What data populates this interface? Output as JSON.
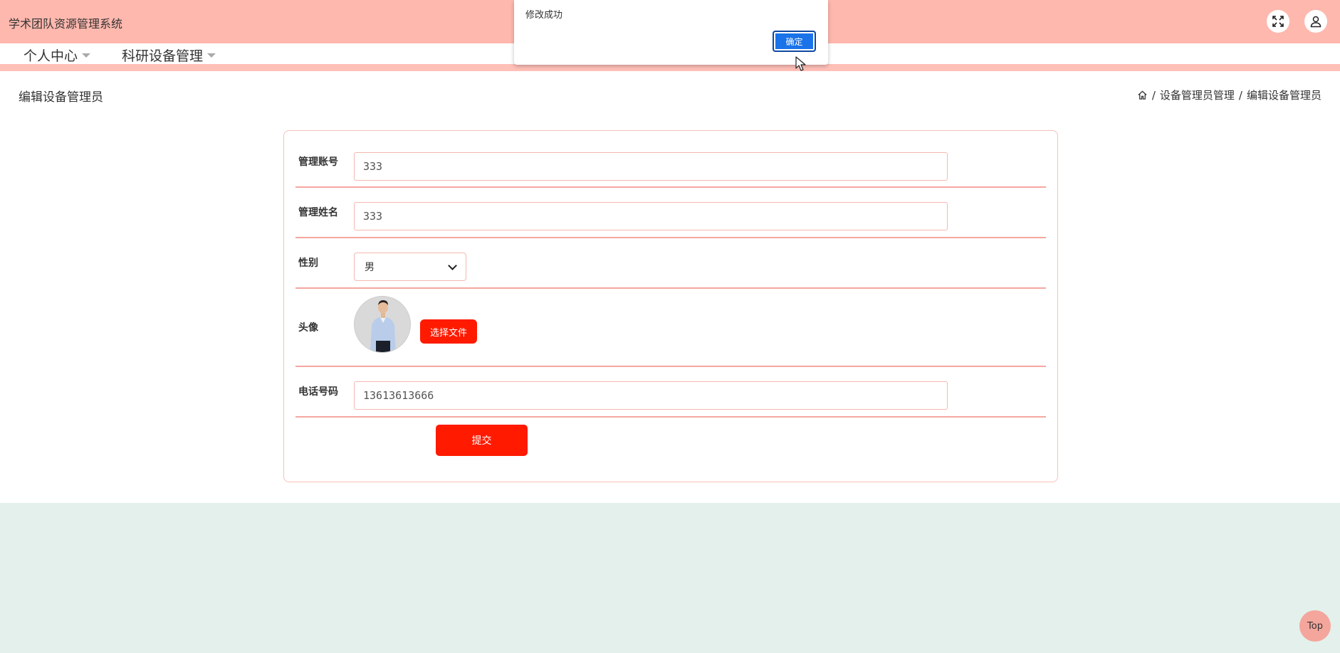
{
  "header": {
    "app_title": "学术团队资源管理系统"
  },
  "nav": {
    "items": [
      {
        "label": "个人中心"
      },
      {
        "label": "科研设备管理"
      }
    ]
  },
  "page": {
    "title": "编辑设备管理员",
    "breadcrumb": {
      "separator": "/",
      "items": [
        "设备管理员管理",
        "编辑设备管理员"
      ]
    }
  },
  "form": {
    "account": {
      "label": "管理账号",
      "value": "333"
    },
    "name": {
      "label": "管理姓名",
      "value": "333"
    },
    "gender": {
      "label": "性别",
      "value": "男"
    },
    "avatar": {
      "label": "头像",
      "file_button": "选择文件"
    },
    "phone": {
      "label": "电话号码",
      "value": "13613613666"
    },
    "submit_label": "提交"
  },
  "dialog": {
    "message": "修改成功",
    "ok_label": "确定"
  },
  "back_to_top": "Top",
  "colors": {
    "header_bg": "#ffb8ae",
    "accent_red": "#ff1a00",
    "dialog_button": "#1a73e8",
    "footer_bg": "#e4f0ec"
  }
}
